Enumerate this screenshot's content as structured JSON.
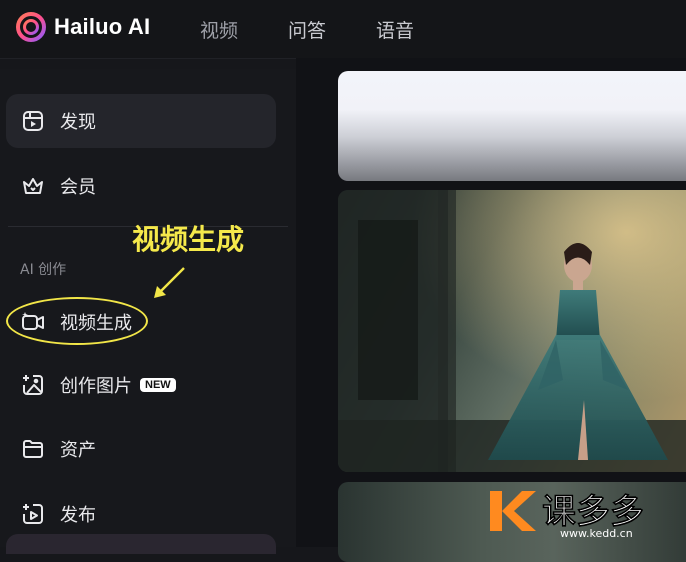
{
  "header": {
    "brand": "Hailuo AI",
    "nav": [
      "视频",
      "问答",
      "语音"
    ]
  },
  "sidebar": {
    "items": [
      {
        "label": "发现",
        "icon": "discover-icon",
        "active": true
      },
      {
        "label": "会员",
        "icon": "crown-icon",
        "active": false
      }
    ],
    "section_label": "AI 创作",
    "create_items": [
      {
        "label": "视频生成",
        "icon": "video-generate-icon"
      },
      {
        "label": "创作图片",
        "icon": "image-create-icon",
        "badge": "NEW"
      },
      {
        "label": "资产",
        "icon": "folder-icon"
      },
      {
        "label": "发布",
        "icon": "publish-icon"
      }
    ]
  },
  "annotation": {
    "text": "视频生成",
    "color": "#f5e94b"
  },
  "watermark": {
    "brand": "课多多",
    "url": "www.kedd.cn"
  },
  "colors": {
    "background": "#16171b",
    "sidebar_active": "#24252b",
    "accent_gradient": [
      "#ff5f8a",
      "#a35dff"
    ]
  }
}
